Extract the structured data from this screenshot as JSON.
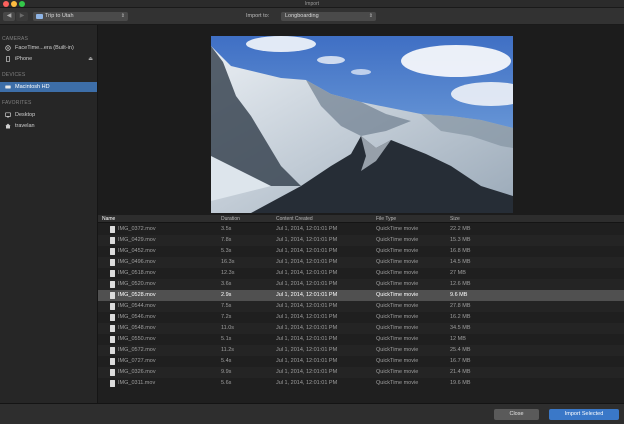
{
  "window": {
    "title": "Import"
  },
  "toolbar": {
    "back": "◀",
    "forward": "▶",
    "location": "Trip to Utah",
    "import_to_label": "Import to:",
    "import_to_value": "Longboarding"
  },
  "sidebar": {
    "cameras_header": "CAMERAS",
    "cameras": [
      {
        "label": "FaceTime...era (Built-in)"
      },
      {
        "label": "iPhone"
      }
    ],
    "devices_header": "DEVICES",
    "devices": [
      {
        "label": "Macintosh HD"
      }
    ],
    "favorites_header": "FAVORITES",
    "favorites": [
      {
        "label": "Desktop"
      },
      {
        "label": "travelan"
      }
    ]
  },
  "table": {
    "columns": [
      "Name",
      "Duration",
      "Content Created",
      "File Type",
      "Size"
    ],
    "rows": [
      {
        "name": "IMG_0372.mov",
        "duration": "3.5s",
        "created": "Jul 1, 2014, 12:01:01 PM",
        "type": "QuickTime movie",
        "size": "22.2 MB"
      },
      {
        "name": "IMG_0429.mov",
        "duration": "7.8s",
        "created": "Jul 1, 2014, 12:01:01 PM",
        "type": "QuickTime movie",
        "size": "15.3 MB"
      },
      {
        "name": "IMG_0452.mov",
        "duration": "5.3s",
        "created": "Jul 1, 2014, 12:01:01 PM",
        "type": "QuickTime movie",
        "size": "16.8 MB"
      },
      {
        "name": "IMG_0496.mov",
        "duration": "16.3s",
        "created": "Jul 1, 2014, 12:01:01 PM",
        "type": "QuickTime movie",
        "size": "14.5 MB"
      },
      {
        "name": "IMG_0518.mov",
        "duration": "12.3s",
        "created": "Jul 1, 2014, 12:01:01 PM",
        "type": "QuickTime movie",
        "size": "27 MB"
      },
      {
        "name": "IMG_0520.mov",
        "duration": "3.6s",
        "created": "Jul 1, 2014, 12:01:01 PM",
        "type": "QuickTime movie",
        "size": "12.6 MB"
      },
      {
        "name": "IMG_0528.mov",
        "duration": "2.9s",
        "created": "Jul 1, 2014, 12:01:01 PM",
        "type": "QuickTime movie",
        "size": "9.6 MB"
      },
      {
        "name": "IMG_0544.mov",
        "duration": "7.5s",
        "created": "Jul 1, 2014, 12:01:01 PM",
        "type": "QuickTime movie",
        "size": "27.8 MB"
      },
      {
        "name": "IMG_0546.mov",
        "duration": "7.2s",
        "created": "Jul 1, 2014, 12:01:01 PM",
        "type": "QuickTime movie",
        "size": "16.2 MB"
      },
      {
        "name": "IMG_0548.mov",
        "duration": "11.0s",
        "created": "Jul 1, 2014, 12:01:01 PM",
        "type": "QuickTime movie",
        "size": "34.5 MB"
      },
      {
        "name": "IMG_0550.mov",
        "duration": "5.1s",
        "created": "Jul 1, 2014, 12:01:01 PM",
        "type": "QuickTime movie",
        "size": "12 MB"
      },
      {
        "name": "IMG_0572.mov",
        "duration": "11.2s",
        "created": "Jul 1, 2014, 12:01:01 PM",
        "type": "QuickTime movie",
        "size": "25.4 MB"
      },
      {
        "name": "IMG_0727.mov",
        "duration": "5.4s",
        "created": "Jul 1, 2014, 12:01:01 PM",
        "type": "QuickTime movie",
        "size": "16.7 MB"
      },
      {
        "name": "IMG_0326.mov",
        "duration": "9.9s",
        "created": "Jul 1, 2014, 12:01:01 PM",
        "type": "QuickTime movie",
        "size": "21.4 MB"
      },
      {
        "name": "IMG_0311.mov",
        "duration": "5.6s",
        "created": "Jul 1, 2014, 12:01:01 PM",
        "type": "QuickTime movie",
        "size": "19.6 MB"
      }
    ],
    "selected_row": 6
  },
  "footer": {
    "close_label": "Close",
    "import_label": "Import Selected"
  },
  "colors": {
    "accent": "#3a78c8",
    "sidebar_selection": "#3d6ea8",
    "close_dot": "#fc615d",
    "minimize_dot": "#fdbc40",
    "zoom_dot": "#34c84a"
  }
}
